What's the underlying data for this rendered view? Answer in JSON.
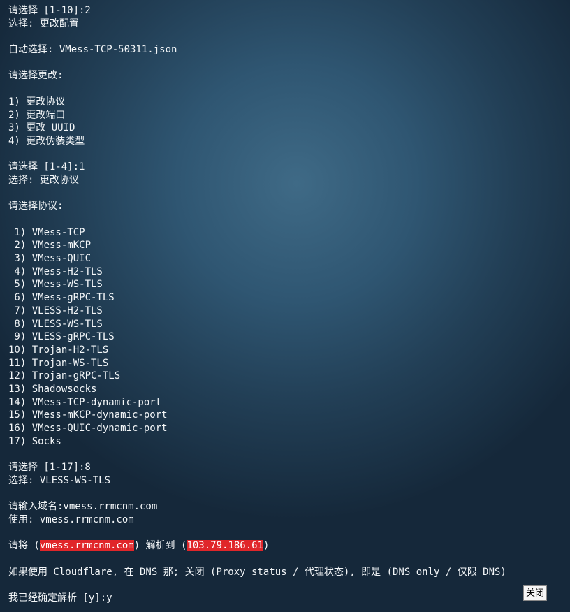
{
  "terminal": {
    "l01": "请选择 [1-10]:2",
    "l02": "选择: 更改配置",
    "l03": "自动选择: VMess-TCP-50311.json",
    "l04": "请选择更改:",
    "l05": "1) 更改协议",
    "l06": "2) 更改端口",
    "l07": "3) 更改 UUID",
    "l08": "4) 更改伪装类型",
    "l09": "请选择 [1-4]:1",
    "l10": "选择: 更改协议",
    "l11": "请选择协议:",
    "protocols": [
      " 1) VMess-TCP",
      " 2) VMess-mKCP",
      " 3) VMess-QUIC",
      " 4) VMess-H2-TLS",
      " 5) VMess-WS-TLS",
      " 6) VMess-gRPC-TLS",
      " 7) VLESS-H2-TLS",
      " 8) VLESS-WS-TLS",
      " 9) VLESS-gRPC-TLS",
      "10) Trojan-H2-TLS",
      "11) Trojan-WS-TLS",
      "12) Trojan-gRPC-TLS",
      "13) Shadowsocks",
      "14) VMess-TCP-dynamic-port",
      "15) VMess-mKCP-dynamic-port",
      "16) VMess-QUIC-dynamic-port",
      "17) Socks"
    ],
    "l12": "请选择 [1-17]:8",
    "l13": "选择: VLESS-WS-TLS",
    "l14": "请输入域名:vmess.rrmcnm.com",
    "l15": "使用: vmess.rrmcnm.com",
    "resolve": {
      "prefix": "请将 (",
      "domain": "vmess.rrmcnm.com",
      "middle": ") 解析到 (",
      "ip": "103.79.186.61",
      "suffix": ")"
    },
    "l16": "如果使用 Cloudflare, 在 DNS 那; 关闭 (Proxy status / 代理状态), 即是 (DNS only / 仅限 DNS)",
    "l17": "我已经确定解析 [y]:y"
  },
  "close_button": {
    "label": "关闭"
  },
  "colors": {
    "highlight": "#e0262a",
    "text": "#f3f6f8"
  }
}
